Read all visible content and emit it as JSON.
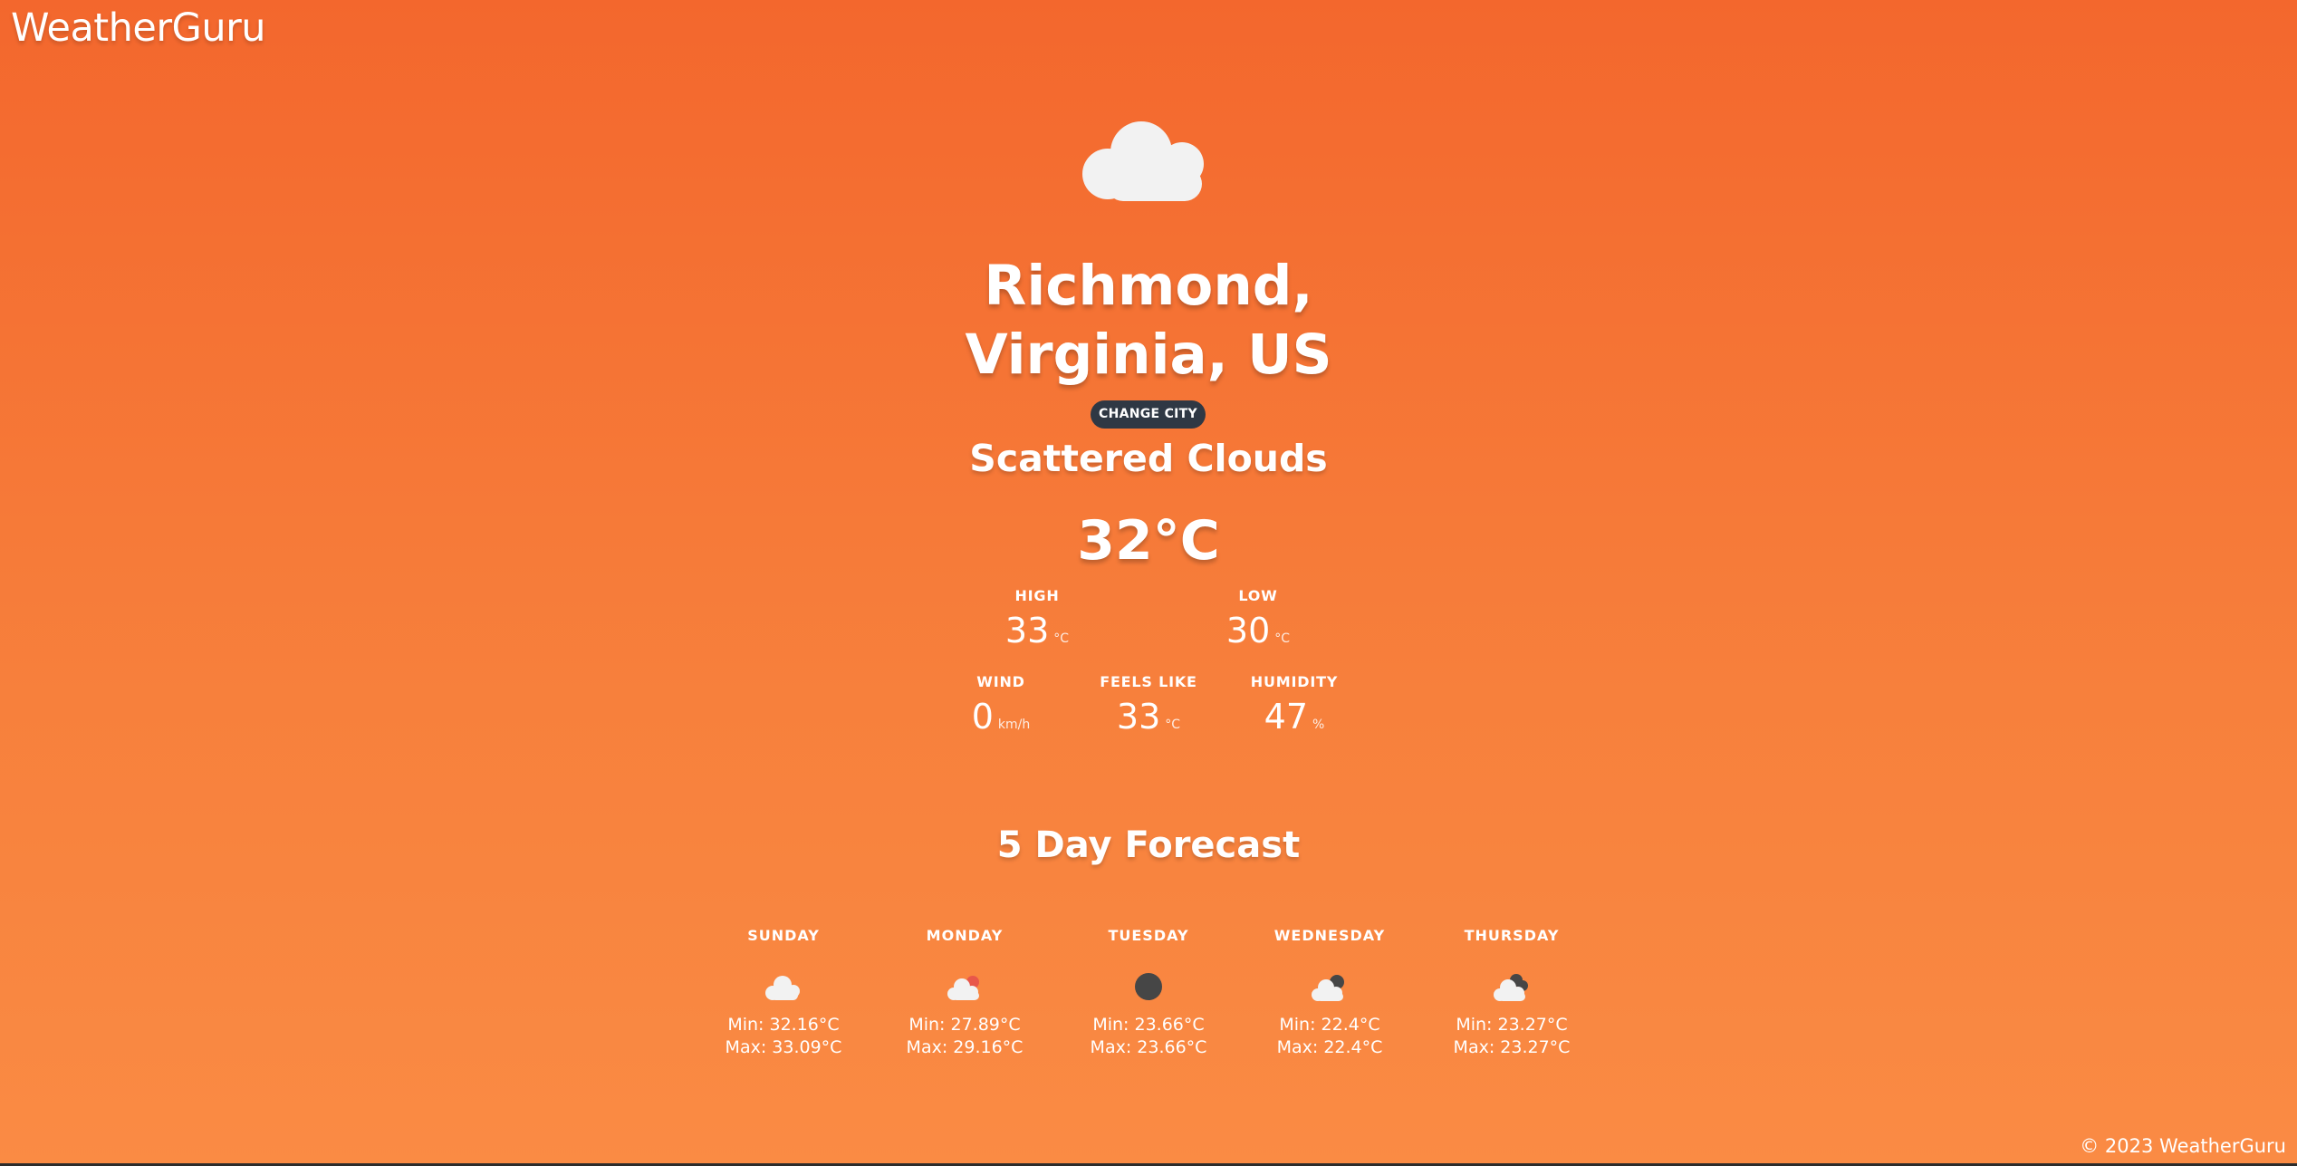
{
  "app": {
    "logo": "WeatherGuru",
    "footer": "© 2023 WeatherGuru"
  },
  "current": {
    "icon": "cloud-icon",
    "city_line1": "Richmond,",
    "city_line2": "Virginia, US",
    "change_city_label": "CHANGE CITY",
    "condition": "Scattered Clouds",
    "temperature": "32°C",
    "high": {
      "label": "HIGH",
      "value": "33",
      "unit": "°C"
    },
    "low": {
      "label": "LOW",
      "value": "30",
      "unit": "°C"
    },
    "wind": {
      "label": "WIND",
      "value": "0",
      "unit": "km/h"
    },
    "feels_like": {
      "label": "FEELS LIKE",
      "value": "33",
      "unit": "°C"
    },
    "humidity": {
      "label": "HUMIDITY",
      "value": "47",
      "unit": "%"
    }
  },
  "forecast": {
    "title": "5 Day Forecast",
    "days": [
      {
        "name": "SUNDAY",
        "icon": "cloud-icon",
        "min": "Min: 32.16°C",
        "max": "Max: 33.09°C"
      },
      {
        "name": "MONDAY",
        "icon": "cloud-sun-icon",
        "min": "Min: 27.89°C",
        "max": "Max: 29.16°C"
      },
      {
        "name": "TUESDAY",
        "icon": "dark-circle-icon",
        "min": "Min: 23.66°C",
        "max": "Max: 23.66°C"
      },
      {
        "name": "WEDNESDAY",
        "icon": "cloud-dark-icon",
        "min": "Min: 22.4°C",
        "max": "Max: 22.4°C"
      },
      {
        "name": "THURSDAY",
        "icon": "cloud-dark-multi-icon",
        "min": "Min: 23.27°C",
        "max": "Max: 23.27°C"
      }
    ]
  },
  "colors": {
    "background_top": "#f3672d",
    "background_bottom": "#fa8b44",
    "button_bg": "#2f3844",
    "icon_white": "#f2f2f2",
    "icon_dark": "#464646",
    "icon_red": "#e8574a"
  }
}
